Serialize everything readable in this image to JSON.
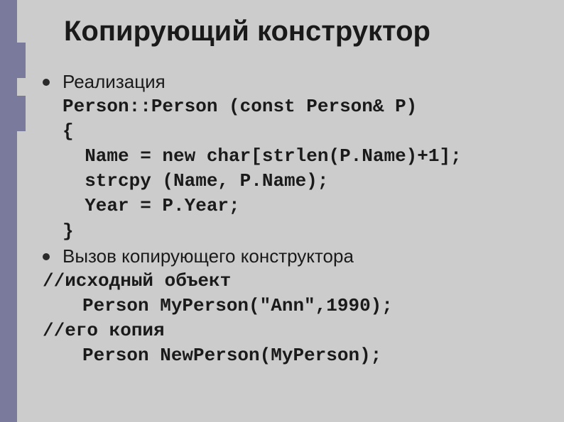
{
  "slide": {
    "title": "Копирующий конструктор",
    "bullet1": "Реализация",
    "code1_line1": "Person::Person (const Person& P)",
    "code1_line2": "{",
    "code1_line3": "  Name = new char[strlen(P.Name)+1];",
    "code1_line4": "  strcpy (Name, P.Name);",
    "code1_line5": "  Year = P.Year;",
    "code1_line6": "}",
    "bullet2": "Вызов копирующего конструктора",
    "comment1": "//исходный объект",
    "invoke1": "Person MyPerson(\"Ann\",1990);",
    "comment2": "//его копия",
    "invoke2": "Person NewPerson(MyPerson);"
  }
}
